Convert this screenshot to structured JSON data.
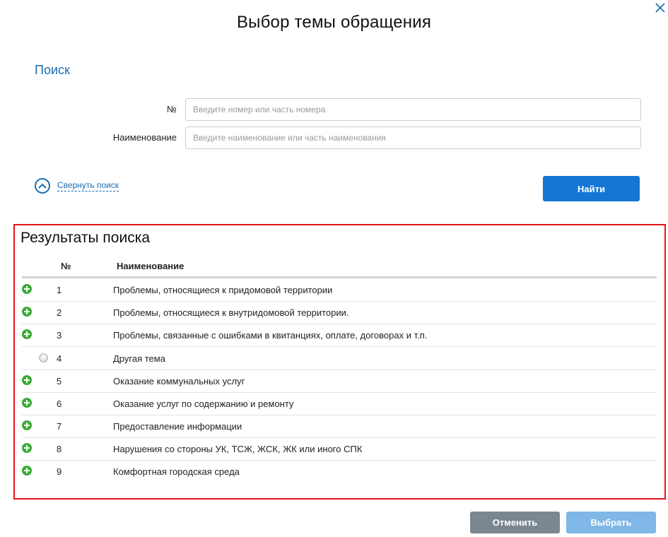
{
  "dialog": {
    "title": "Выбор темы обращения"
  },
  "search": {
    "heading": "Поиск",
    "number_label": "№",
    "number_placeholder": "Введите номер или часть номера",
    "number_value": "",
    "name_label": "Наименование",
    "name_placeholder": "Введите наименование или часть наименования",
    "name_value": "",
    "collapse_label": "Свернуть поиск",
    "find_button": "Найти"
  },
  "results": {
    "title": "Результаты поиска",
    "columns": {
      "number": "№",
      "name": "Наименование"
    },
    "rows": [
      {
        "number": "1",
        "name": "Проблемы, относящиеся к придомовой территории",
        "icon": "plus-circle-icon"
      },
      {
        "number": "2",
        "name": "Проблемы, относящиеся к внутридомовой территории.",
        "icon": "plus-circle-icon"
      },
      {
        "number": "3",
        "name": "Проблемы, связанные с ошибками в квитанциях, оплате, договорах и т.п.",
        "icon": "plus-circle-icon"
      },
      {
        "number": "4",
        "name": "Другая тема",
        "icon": "radio-icon"
      },
      {
        "number": "5",
        "name": "Оказание коммунальных услуг",
        "icon": "plus-circle-icon"
      },
      {
        "number": "6",
        "name": "Оказание услуг по содержанию и ремонту",
        "icon": "plus-circle-icon"
      },
      {
        "number": "7",
        "name": "Предоставление информации",
        "icon": "plus-circle-icon"
      },
      {
        "number": "8",
        "name": "Нарушения со стороны УК, ТСЖ, ЖСК, ЖК или иного СПК",
        "icon": "plus-circle-icon"
      },
      {
        "number": "9",
        "name": "Комфортная городская среда",
        "icon": "plus-circle-icon"
      }
    ]
  },
  "footer": {
    "cancel_button": "Отменить",
    "select_button": "Выбрать"
  },
  "colors": {
    "accent": "#1477d4",
    "link": "#1a6bb0",
    "expand_icon": "#3aaa35",
    "highlight_border": "#e3141b",
    "cancel_bg": "#7b8790",
    "select_bg_disabled": "#7fb7e6"
  }
}
